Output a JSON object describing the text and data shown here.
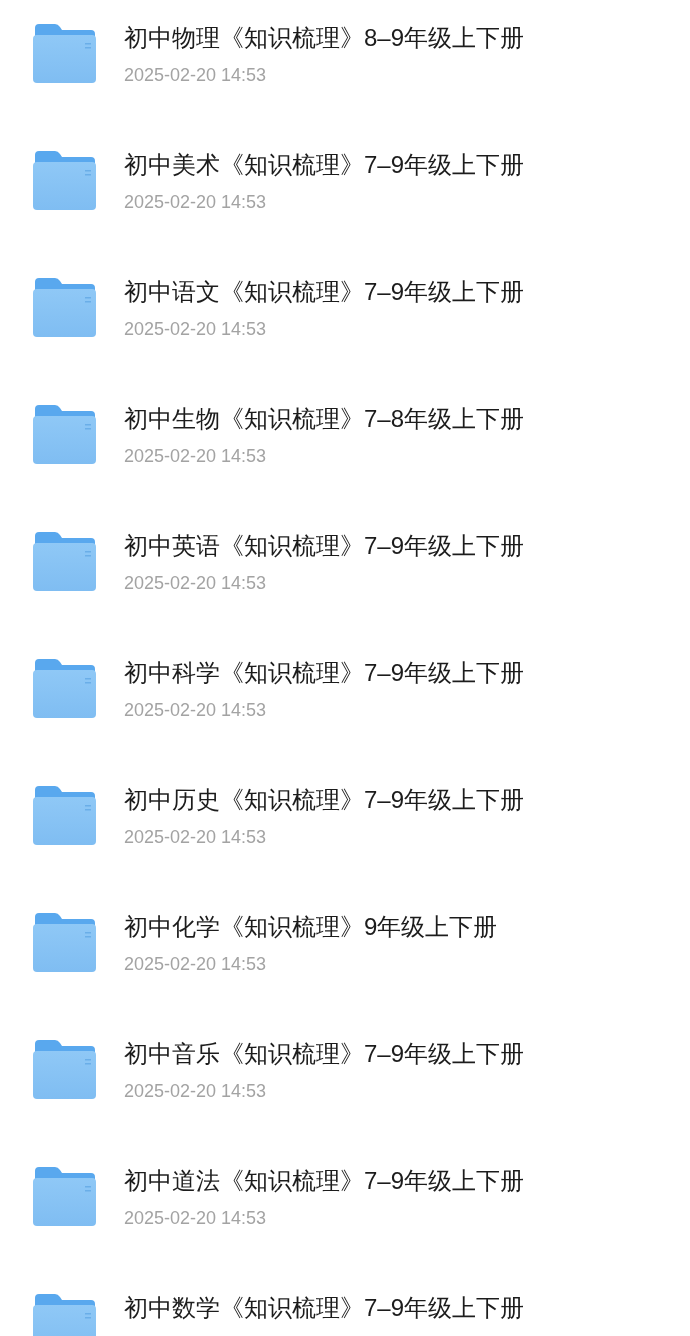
{
  "files": [
    {
      "name": "初中物理《知识梳理》8–9年级上下册",
      "date": "2025-02-20 14:53"
    },
    {
      "name": "初中美术《知识梳理》7–9年级上下册",
      "date": "2025-02-20 14:53"
    },
    {
      "name": "初中语文《知识梳理》7–9年级上下册",
      "date": "2025-02-20 14:53"
    },
    {
      "name": "初中生物《知识梳理》7–8年级上下册",
      "date": "2025-02-20 14:53"
    },
    {
      "name": "初中英语《知识梳理》7–9年级上下册",
      "date": "2025-02-20 14:53"
    },
    {
      "name": "初中科学《知识梳理》7–9年级上下册",
      "date": "2025-02-20 14:53"
    },
    {
      "name": "初中历史《知识梳理》7–9年级上下册",
      "date": "2025-02-20 14:53"
    },
    {
      "name": "初中化学《知识梳理》9年级上下册",
      "date": "2025-02-20 14:53"
    },
    {
      "name": "初中音乐《知识梳理》7–9年级上下册",
      "date": "2025-02-20 14:53"
    },
    {
      "name": "初中道法《知识梳理》7–9年级上下册",
      "date": "2025-02-20 14:53"
    },
    {
      "name": "初中数学《知识梳理》7–9年级上下册"
    }
  ]
}
